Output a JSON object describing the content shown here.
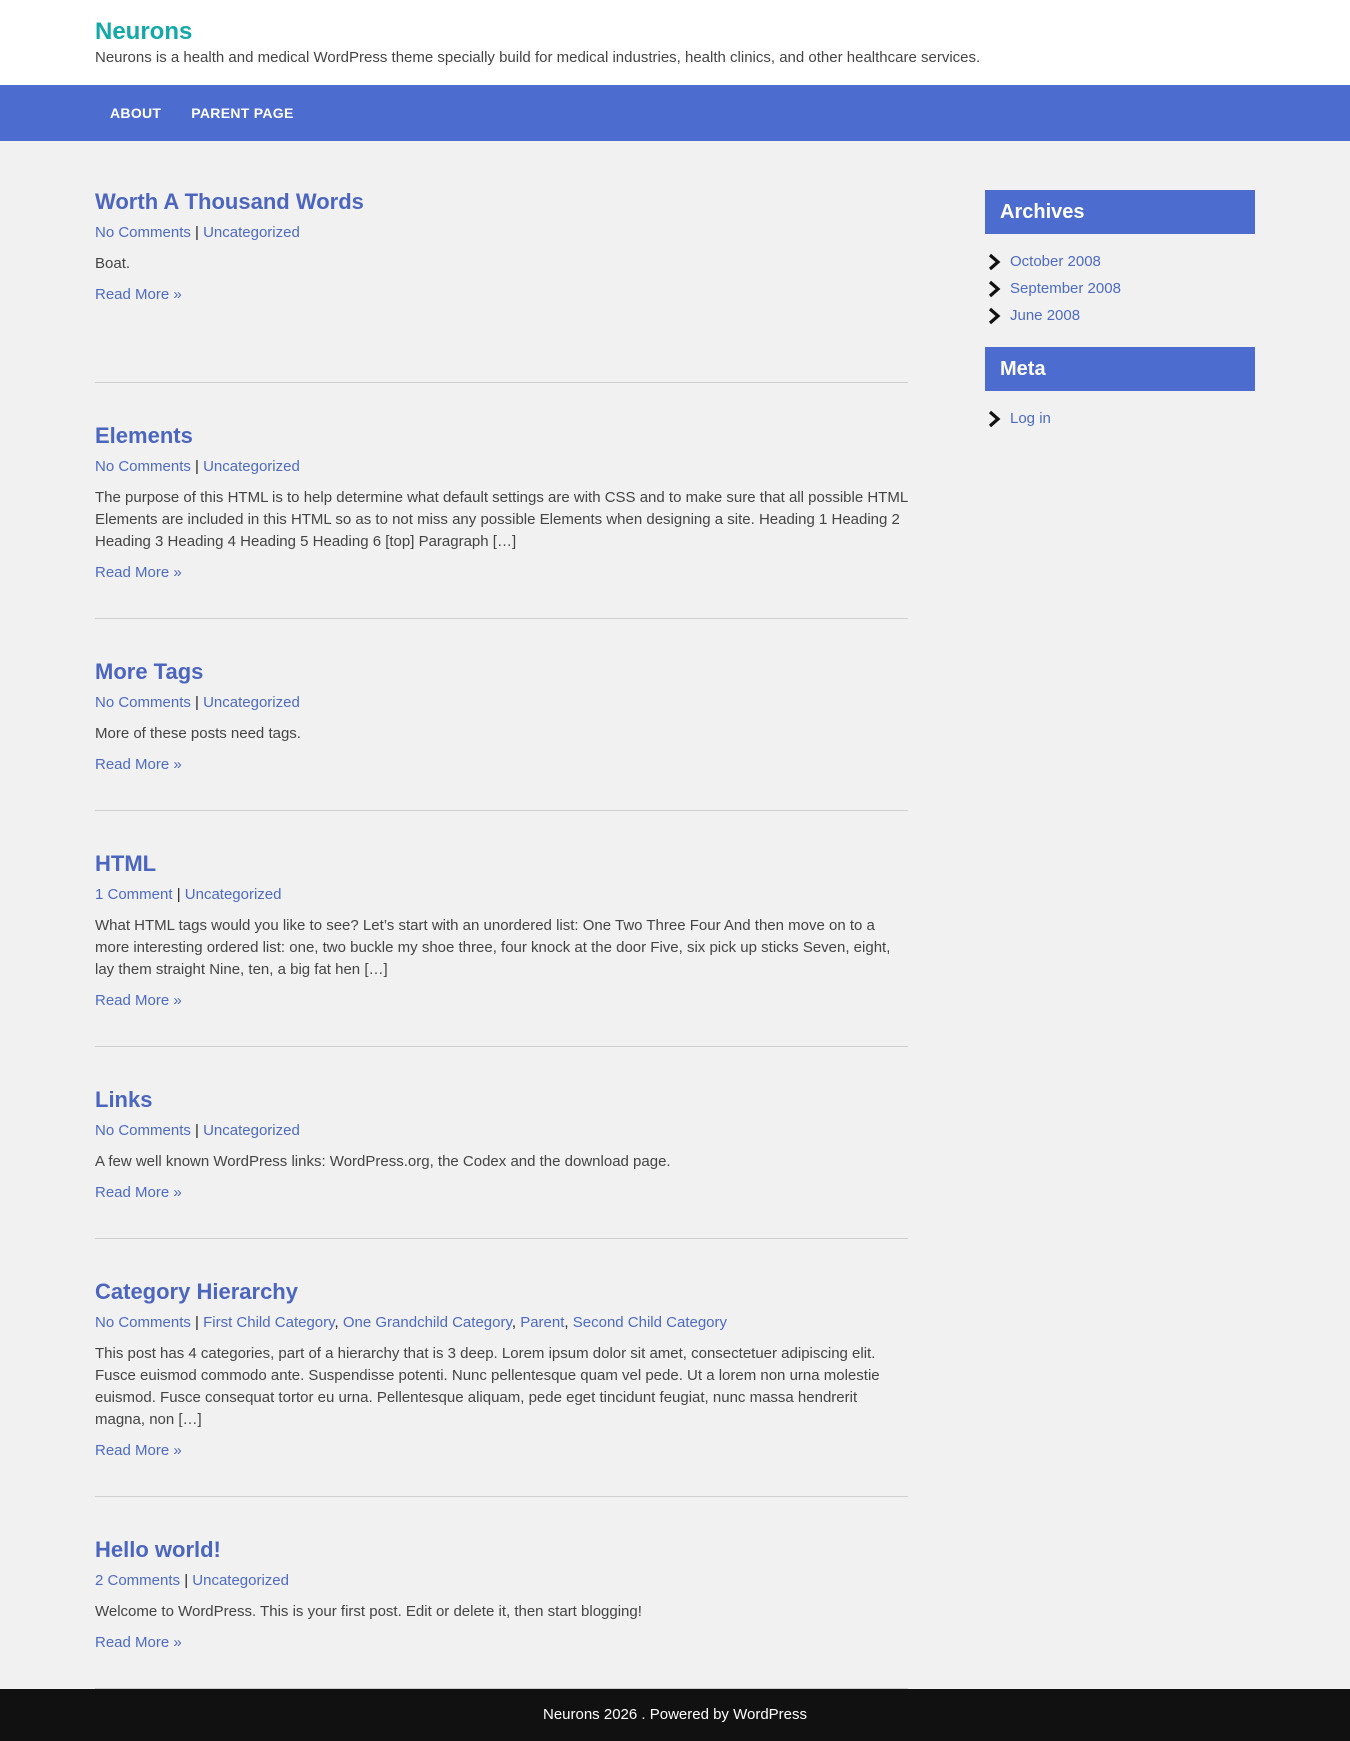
{
  "site": {
    "title": "Neurons",
    "description": "Neurons is a health and medical WordPress theme specially build for medical industries, health clinics, and other healthcare services."
  },
  "nav": {
    "items": [
      "ABOUT",
      "PARENT PAGE"
    ]
  },
  "posts": [
    {
      "title": "Worth A Thousand Words",
      "comments": "No Comments",
      "categories": [
        "Uncategorized"
      ],
      "excerpt": "Boat.",
      "read_more": "Read More »"
    },
    {
      "title": "Elements",
      "comments": "No Comments",
      "categories": [
        "Uncategorized"
      ],
      "excerpt": "The purpose of this HTML is to help determine what default settings are with CSS and to make sure that all possible HTML Elements are included in this HTML so as to not miss any possible Elements when designing a site. Heading 1 Heading 2 Heading 3 Heading 4 Heading 5 Heading 6 [top] Paragraph […]",
      "read_more": "Read More »"
    },
    {
      "title": "More Tags",
      "comments": "No Comments",
      "categories": [
        "Uncategorized"
      ],
      "excerpt": "More of these posts need tags.",
      "read_more": "Read More »"
    },
    {
      "title": "HTML",
      "comments": "1 Comment",
      "categories": [
        "Uncategorized"
      ],
      "excerpt": "What HTML tags would you like to see? Let’s start with an unordered list: One Two Three Four And then move on to a more interesting ordered list: one, two buckle my shoe three, four knock at the door Five, six pick up sticks Seven, eight, lay them straight Nine, ten, a big fat hen […]",
      "read_more": "Read More »"
    },
    {
      "title": "Links",
      "comments": "No Comments",
      "categories": [
        "Uncategorized"
      ],
      "excerpt": "A few well known WordPress links: WordPress.org, the Codex and the download page.",
      "read_more": "Read More »"
    },
    {
      "title": "Category Hierarchy",
      "comments": "No Comments",
      "categories": [
        "First Child Category",
        "One Grandchild Category",
        "Parent",
        "Second Child Category"
      ],
      "excerpt": "This post has 4 categories, part of a hierarchy that is 3 deep. Lorem ipsum dolor sit amet, consectetuer adipiscing elit. Fusce euismod commodo ante. Suspendisse potenti. Nunc pellentesque quam vel pede. Ut a lorem non urna molestie euismod. Fusce consequat tortor eu urna. Pellentesque aliquam, pede eget tincidunt feugiat, nunc massa hendrerit magna, non […]",
      "read_more": "Read More »"
    },
    {
      "title": "Hello world!",
      "comments": "2 Comments",
      "categories": [
        "Uncategorized"
      ],
      "excerpt": "Welcome to WordPress. This is your first post. Edit or delete it, then start blogging!",
      "read_more": "Read More »"
    }
  ],
  "sidebar": {
    "archives": {
      "title": "Archives",
      "items": [
        "October 2008",
        "September 2008",
        "June 2008"
      ]
    },
    "meta": {
      "title": "Meta",
      "items": [
        "Log in"
      ]
    },
    "list_icon": "chevron-right-icon"
  },
  "footer": {
    "text": "Neurons 2026 . Powered by WordPress"
  },
  "colors": {
    "accent": "#4c6cd0",
    "title": "#15a8a8",
    "link": "#4e6bc4",
    "footer_bg": "#111111"
  }
}
